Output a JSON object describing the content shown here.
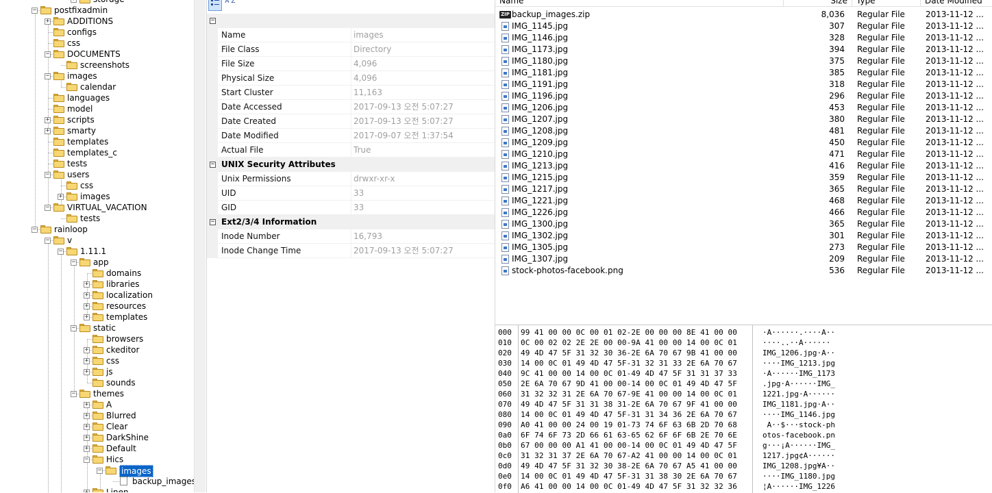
{
  "tree": {
    "items": [
      {
        "label": "storage",
        "depth": 5,
        "expander": "+",
        "partial": true
      },
      {
        "label": "postfixadmin",
        "depth": 2,
        "expander": "-"
      },
      {
        "label": "ADDITIONS",
        "depth": 3,
        "expander": "+"
      },
      {
        "label": "configs",
        "depth": 3,
        "expander": ""
      },
      {
        "label": "css",
        "depth": 3,
        "expander": ""
      },
      {
        "label": "DOCUMENTS",
        "depth": 3,
        "expander": "-"
      },
      {
        "label": "screenshots",
        "depth": 4,
        "expander": ""
      },
      {
        "label": "images",
        "depth": 3,
        "expander": "-"
      },
      {
        "label": "calendar",
        "depth": 4,
        "expander": ""
      },
      {
        "label": "languages",
        "depth": 3,
        "expander": ""
      },
      {
        "label": "model",
        "depth": 3,
        "expander": ""
      },
      {
        "label": "scripts",
        "depth": 3,
        "expander": "+"
      },
      {
        "label": "smarty",
        "depth": 3,
        "expander": "+"
      },
      {
        "label": "templates",
        "depth": 3,
        "expander": ""
      },
      {
        "label": "templates_c",
        "depth": 3,
        "expander": ""
      },
      {
        "label": "tests",
        "depth": 3,
        "expander": ""
      },
      {
        "label": "users",
        "depth": 3,
        "expander": "-"
      },
      {
        "label": "css",
        "depth": 4,
        "expander": ""
      },
      {
        "label": "images",
        "depth": 4,
        "expander": "+"
      },
      {
        "label": "VIRTUAL_VACATION",
        "depth": 3,
        "expander": "-"
      },
      {
        "label": "tests",
        "depth": 4,
        "expander": ""
      },
      {
        "label": "rainloop",
        "depth": 2,
        "expander": "-"
      },
      {
        "label": "v",
        "depth": 3,
        "expander": "-"
      },
      {
        "label": "1.11.1",
        "depth": 4,
        "expander": "-"
      },
      {
        "label": "app",
        "depth": 5,
        "expander": "-"
      },
      {
        "label": "domains",
        "depth": 6,
        "expander": ""
      },
      {
        "label": "libraries",
        "depth": 6,
        "expander": "+"
      },
      {
        "label": "localization",
        "depth": 6,
        "expander": "+"
      },
      {
        "label": "resources",
        "depth": 6,
        "expander": "+"
      },
      {
        "label": "templates",
        "depth": 6,
        "expander": "+"
      },
      {
        "label": "static",
        "depth": 5,
        "expander": "-"
      },
      {
        "label": "browsers",
        "depth": 6,
        "expander": ""
      },
      {
        "label": "ckeditor",
        "depth": 6,
        "expander": "+"
      },
      {
        "label": "css",
        "depth": 6,
        "expander": "+"
      },
      {
        "label": "js",
        "depth": 6,
        "expander": "+"
      },
      {
        "label": "sounds",
        "depth": 6,
        "expander": ""
      },
      {
        "label": "themes",
        "depth": 5,
        "expander": "-"
      },
      {
        "label": "A",
        "depth": 6,
        "expander": "+"
      },
      {
        "label": "Blurred",
        "depth": 6,
        "expander": "+"
      },
      {
        "label": "Clear",
        "depth": 6,
        "expander": "+"
      },
      {
        "label": "DarkShine",
        "depth": 6,
        "expander": "+"
      },
      {
        "label": "Default",
        "depth": 6,
        "expander": "+"
      },
      {
        "label": "Hics",
        "depth": 6,
        "expander": "-"
      },
      {
        "label": "images",
        "depth": 7,
        "expander": "-",
        "selected": true
      },
      {
        "label": "backup_images",
        "depth": 8,
        "expander": "",
        "file": true
      },
      {
        "label": "Linen",
        "depth": 6,
        "expander": "+",
        "partial": true
      }
    ]
  },
  "properties": {
    "toolbar": {
      "categorized_label": "",
      "alpha_label": "A Z"
    },
    "groups": [
      {
        "title": "",
        "rows": [
          {
            "name": "Name",
            "value": "images"
          },
          {
            "name": "File Class",
            "value": "Directory"
          },
          {
            "name": "File Size",
            "value": "4,096"
          },
          {
            "name": "Physical Size",
            "value": "4,096"
          },
          {
            "name": "Start Cluster",
            "value": "11,163"
          },
          {
            "name": "Date Accessed",
            "value": "2017-09-13 오전 5:07:27"
          },
          {
            "name": "Date Created",
            "value": "2017-09-13 오전 5:07:27"
          },
          {
            "name": "Date Modified",
            "value": "2017-09-07 오전 1:37:54"
          },
          {
            "name": "Actual File",
            "value": "True"
          }
        ]
      },
      {
        "title": "UNIX Security Attributes",
        "rows": [
          {
            "name": "Unix Permissions",
            "value": "drwxr-xr-x"
          },
          {
            "name": "UID",
            "value": "33"
          },
          {
            "name": "GID",
            "value": "33"
          }
        ]
      },
      {
        "title": "Ext2/3/4 Information",
        "rows": [
          {
            "name": "Inode Number",
            "value": "16,793"
          },
          {
            "name": "Inode Change Time",
            "value": "2017-09-13 오전 5:07:27"
          }
        ]
      }
    ]
  },
  "filelist": {
    "columns": {
      "name": "Name",
      "size": "Size",
      "type": "Type",
      "date": "Date Modified"
    },
    "files": [
      {
        "name": "backup_images.zip",
        "size": "8,036",
        "type": "Regular File",
        "date": "2013-11-12 ...",
        "icon": "zip"
      },
      {
        "name": "IMG_1145.jpg",
        "size": "307",
        "type": "Regular File",
        "date": "2013-11-12 ..."
      },
      {
        "name": "IMG_1146.jpg",
        "size": "328",
        "type": "Regular File",
        "date": "2013-11-12 ..."
      },
      {
        "name": "IMG_1173.jpg",
        "size": "394",
        "type": "Regular File",
        "date": "2013-11-12 ..."
      },
      {
        "name": "IMG_1180.jpg",
        "size": "375",
        "type": "Regular File",
        "date": "2013-11-12 ..."
      },
      {
        "name": "IMG_1181.jpg",
        "size": "385",
        "type": "Regular File",
        "date": "2013-11-12 ..."
      },
      {
        "name": "IMG_1191.jpg",
        "size": "318",
        "type": "Regular File",
        "date": "2013-11-12 ..."
      },
      {
        "name": "IMG_1196.jpg",
        "size": "296",
        "type": "Regular File",
        "date": "2013-11-12 ..."
      },
      {
        "name": "IMG_1206.jpg",
        "size": "453",
        "type": "Regular File",
        "date": "2013-11-12 ..."
      },
      {
        "name": "IMG_1207.jpg",
        "size": "380",
        "type": "Regular File",
        "date": "2013-11-12 ..."
      },
      {
        "name": "IMG_1208.jpg",
        "size": "481",
        "type": "Regular File",
        "date": "2013-11-12 ..."
      },
      {
        "name": "IMG_1209.jpg",
        "size": "450",
        "type": "Regular File",
        "date": "2013-11-12 ..."
      },
      {
        "name": "IMG_1210.jpg",
        "size": "471",
        "type": "Regular File",
        "date": "2013-11-12 ..."
      },
      {
        "name": "IMG_1213.jpg",
        "size": "416",
        "type": "Regular File",
        "date": "2013-11-12 ..."
      },
      {
        "name": "IMG_1215.jpg",
        "size": "359",
        "type": "Regular File",
        "date": "2013-11-12 ..."
      },
      {
        "name": "IMG_1217.jpg",
        "size": "365",
        "type": "Regular File",
        "date": "2013-11-12 ..."
      },
      {
        "name": "IMG_1221.jpg",
        "size": "468",
        "type": "Regular File",
        "date": "2013-11-12 ..."
      },
      {
        "name": "IMG_1226.jpg",
        "size": "466",
        "type": "Regular File",
        "date": "2013-11-12 ..."
      },
      {
        "name": "IMG_1300.jpg",
        "size": "365",
        "type": "Regular File",
        "date": "2013-11-12 ..."
      },
      {
        "name": "IMG_1302.jpg",
        "size": "301",
        "type": "Regular File",
        "date": "2013-11-12 ..."
      },
      {
        "name": "IMG_1305.jpg",
        "size": "273",
        "type": "Regular File",
        "date": "2013-11-12 ..."
      },
      {
        "name": "IMG_1307.jpg",
        "size": "209",
        "type": "Regular File",
        "date": "2013-11-12 ..."
      },
      {
        "name": "stock-photos-facebook.png",
        "size": "536",
        "type": "Regular File",
        "date": "2013-11-12 ..."
      }
    ]
  },
  "hex": {
    "rows": [
      {
        "offset": "000",
        "bytes": "99 41 00 00 0C 00 01 02-2E 00 00 00 8E 41 00 00",
        "ascii": "·A······.····A··"
      },
      {
        "offset": "010",
        "bytes": "0C 00 02 02 2E 2E 00 00-9A 41 00 00 14 00 0C 01",
        "ascii": "····..··A······"
      },
      {
        "offset": "020",
        "bytes": "49 4D 47 5F 31 32 30 36-2E 6A 70 67 9B 41 00 00",
        "ascii": "IMG_1206.jpg·A··"
      },
      {
        "offset": "030",
        "bytes": "14 00 0C 01 49 4D 47 5F-31 32 31 33 2E 6A 70 67",
        "ascii": "····IMG_1213.jpg"
      },
      {
        "offset": "040",
        "bytes": "9C 41 00 00 14 00 0C 01-49 4D 47 5F 31 31 37 33",
        "ascii": "·A······IMG_1173"
      },
      {
        "offset": "050",
        "bytes": "2E 6A 70 67 9D 41 00 00-14 00 0C 01 49 4D 47 5F",
        "ascii": ".jpg·A······IMG_"
      },
      {
        "offset": "060",
        "bytes": "31 32 32 31 2E 6A 70 67-9E 41 00 00 14 00 0C 01",
        "ascii": "1221.jpg·A······"
      },
      {
        "offset": "070",
        "bytes": "49 4D 47 5F 31 31 38 31-2E 6A 70 67 9F 41 00 00",
        "ascii": "IMG_1181.jpg·A··"
      },
      {
        "offset": "080",
        "bytes": "14 00 0C 01 49 4D 47 5F-31 31 34 36 2E 6A 70 67",
        "ascii": "····IMG_1146.jpg"
      },
      {
        "offset": "090",
        "bytes": "A0 41 00 00 24 00 19 01-73 74 6F 63 6B 2D 70 68",
        "ascii": " A··$···stock-ph"
      },
      {
        "offset": "0a0",
        "bytes": "6F 74 6F 73 2D 66 61 63-65 62 6F 6F 6B 2E 70 6E",
        "ascii": "otos-facebook.pn"
      },
      {
        "offset": "0b0",
        "bytes": "67 00 00 00 A1 41 00 00-14 00 0C 01 49 4D 47 5F",
        "ascii": "g···¡A······IMG_"
      },
      {
        "offset": "0c0",
        "bytes": "31 32 31 37 2E 6A 70 67-A2 41 00 00 14 00 0C 01",
        "ascii": "1217.jpg¢A······"
      },
      {
        "offset": "0d0",
        "bytes": "49 4D 47 5F 31 32 30 38-2E 6A 70 67 A5 41 00 00",
        "ascii": "IMG_1208.jpg¥A··"
      },
      {
        "offset": "0e0",
        "bytes": "14 00 0C 01 49 4D 47 5F-31 31 38 30 2E 6A 70 67",
        "ascii": "····IMG_1180.jpg"
      },
      {
        "offset": "0f0",
        "bytes": "A6 41 00 00 14 00 0C 01-49 4D 47 5F 31 32 32 36",
        "ascii": "¦A······IMG_1226"
      }
    ]
  }
}
